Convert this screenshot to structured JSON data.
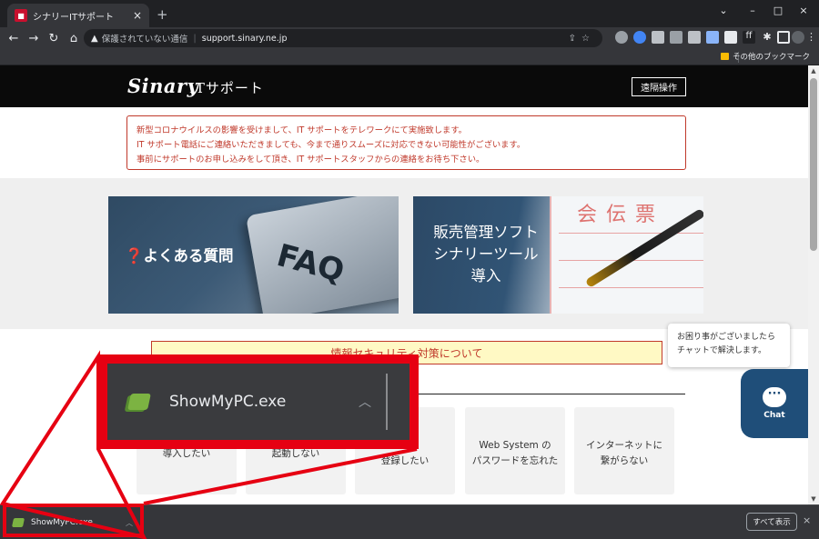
{
  "browser": {
    "tab_title": "シナリーITサポート",
    "tab_close": "×",
    "new_tab": "+",
    "window_controls": [
      "⌄",
      "–",
      "□",
      "×"
    ],
    "security_label": "保護されていない通信",
    "url": "support.sinary.ne.jp",
    "bookmark_other": "その他のブックマーク"
  },
  "site": {
    "logo": "Sinary",
    "logo_sub": "ITサポート",
    "remote_button": "遠隔操作",
    "notice_lines": [
      "新型コロナウイルスの影響を受けまして、IT サポートをテレワークにて実施致します。",
      "IT サポート電話にご連絡いただきましても、今まで通りスムーズに対応できない可能性がございます。",
      "事前にサポートのお申し込みをして頂き、IT サポートスタッフからの連絡をお待ち下さい。"
    ],
    "faq_card": {
      "label": "よくある質問",
      "image_text": "FAQ"
    },
    "sales_card": {
      "line1": "販売管理ソフト",
      "line2": "シナリーツール",
      "line3": "導入",
      "doc_kanji": "会伝票"
    },
    "security_banner": "情報セキュリティ対策について",
    "topics": [
      {
        "line1": "",
        "line2": "導入したい"
      },
      {
        "line1": "",
        "line2": "起動しない"
      },
      {
        "line1": "に",
        "line2": "登録したい"
      },
      {
        "line1": "Web System の",
        "line2": "パスワードを忘れた"
      },
      {
        "line1": "インターネットに",
        "line2": "繋がらない"
      }
    ],
    "chat_bubble_line1": "お困り事がございましたら",
    "chat_bubble_line2": "チャットで解決します。",
    "chat_button": "Chat"
  },
  "downloads": {
    "filename": "ShowMyPC.exe",
    "show_all": "すべて表示",
    "close": "×"
  },
  "callout": {
    "filename": "ShowMyPC.exe",
    "color": "#e60012"
  }
}
